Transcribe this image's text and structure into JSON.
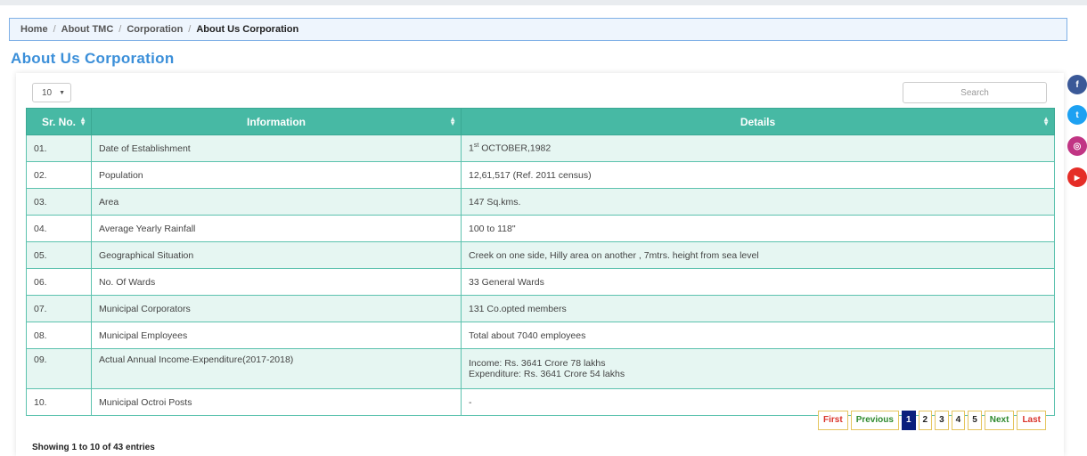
{
  "breadcrumb": [
    "Home",
    "About TMC",
    "Corporation",
    "About Us Corporation"
  ],
  "page_title": "About Us Corporation",
  "length": {
    "value": "10",
    "arrow": "▼"
  },
  "search": {
    "placeholder": "Search"
  },
  "table": {
    "headers": [
      "Sr. No.",
      "Information",
      "Details"
    ],
    "rows": [
      {
        "sr": "01.",
        "info": "Date of Establishment",
        "details_sup": "st",
        "details_pre": "1",
        "details_post": " OCTOBER,1982"
      },
      {
        "sr": "02.",
        "info": "Population",
        "details": "12,61,517 (Ref. 2011 census)"
      },
      {
        "sr": "03.",
        "info": "Area",
        "details": "147 Sq.kms."
      },
      {
        "sr": "04.",
        "info": "Average Yearly Rainfall",
        "details": "100 to 118\""
      },
      {
        "sr": "05.",
        "info": "Geographical Situation",
        "details": "Creek on one side, Hilly area on another , 7mtrs. height from sea level"
      },
      {
        "sr": "06.",
        "info": "No. Of Wards",
        "details": "33 General Wards"
      },
      {
        "sr": "07.",
        "info": "Municipal Corporators",
        "details": "131 Co.opted members"
      },
      {
        "sr": "08.",
        "info": "Municipal Employees",
        "details": "Total about 7040 employees"
      },
      {
        "sr": "09.",
        "info": "Actual Annual Income-Expenditure(2017-2018)",
        "details": "Income: Rs. 3641 Crore 78 lakhs",
        "details2": "Expenditure: Rs. 3641 Crore 54 lakhs"
      },
      {
        "sr": "10.",
        "info": "Municipal Octroi Posts",
        "details": "-"
      }
    ]
  },
  "pager": {
    "first": "First",
    "previous": "Previous",
    "pages": [
      "1",
      "2",
      "3",
      "4",
      "5"
    ],
    "next": "Next",
    "last": "Last"
  },
  "info_text": "Showing 1 to 10 of 43 entries",
  "social": [
    {
      "icon": "facebook-icon",
      "glyph": "f",
      "color": "#3b5998"
    },
    {
      "icon": "twitter-icon",
      "glyph": "t",
      "color": "#1da1f2"
    },
    {
      "icon": "instagram-icon",
      "glyph": "◎",
      "color": "#c13584"
    },
    {
      "icon": "youtube-icon",
      "glyph": "▶",
      "color": "#e52d27"
    }
  ]
}
